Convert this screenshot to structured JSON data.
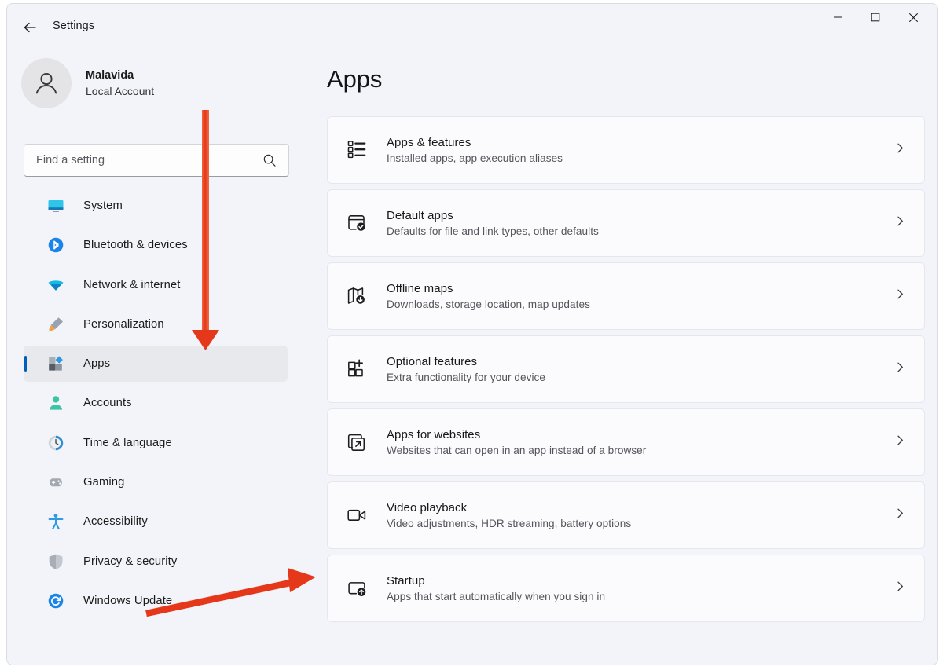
{
  "window": {
    "title": "Settings",
    "back_icon": "back-arrow-icon",
    "controls": {
      "minimize": "minimize-icon",
      "maximize": "maximize-icon",
      "close": "close-icon"
    }
  },
  "sidebar": {
    "profile": {
      "name": "Malavida",
      "subtitle": "Local Account",
      "avatar_icon": "person-avatar-icon"
    },
    "search": {
      "placeholder": "Find a setting",
      "value": "",
      "icon": "search-icon"
    },
    "items": [
      {
        "label": "System",
        "icon": "monitor-icon",
        "selected": false
      },
      {
        "label": "Bluetooth & devices",
        "icon": "bluetooth-icon",
        "selected": false
      },
      {
        "label": "Network & internet",
        "icon": "wifi-icon",
        "selected": false
      },
      {
        "label": "Personalization",
        "icon": "paintbrush-icon",
        "selected": false
      },
      {
        "label": "Apps",
        "icon": "apps-icon",
        "selected": true
      },
      {
        "label": "Accounts",
        "icon": "person-icon",
        "selected": false
      },
      {
        "label": "Time & language",
        "icon": "clock-icon",
        "selected": false
      },
      {
        "label": "Gaming",
        "icon": "gamepad-icon",
        "selected": false
      },
      {
        "label": "Accessibility",
        "icon": "accessibility-icon",
        "selected": false
      },
      {
        "label": "Privacy & security",
        "icon": "shield-icon",
        "selected": false
      },
      {
        "label": "Windows Update",
        "icon": "update-icon",
        "selected": false
      }
    ]
  },
  "main": {
    "title": "Apps",
    "cards": [
      {
        "title": "Apps & features",
        "subtitle": "Installed apps, app execution aliases",
        "icon": "list-bullets-icon",
        "chevron": "chevron-right-icon"
      },
      {
        "title": "Default apps",
        "subtitle": "Defaults for file and link types, other defaults",
        "icon": "window-check-icon",
        "chevron": "chevron-right-icon"
      },
      {
        "title": "Offline maps",
        "subtitle": "Downloads, storage location, map updates",
        "icon": "map-download-icon",
        "chevron": "chevron-right-icon"
      },
      {
        "title": "Optional features",
        "subtitle": "Extra functionality for your device",
        "icon": "grid-plus-icon",
        "chevron": "chevron-right-icon"
      },
      {
        "title": "Apps for websites",
        "subtitle": "Websites that can open in an app instead of a browser",
        "icon": "external-link-stack-icon",
        "chevron": "chevron-right-icon"
      },
      {
        "title": "Video playback",
        "subtitle": "Video adjustments, HDR streaming, battery options",
        "icon": "video-camera-icon",
        "chevron": "chevron-right-icon"
      },
      {
        "title": "Startup",
        "subtitle": "Apps that start automatically when you sign in",
        "icon": "window-up-arrow-icon",
        "chevron": "chevron-right-icon"
      }
    ]
  },
  "annotations": {
    "color": "#ea3a1b",
    "arrows": [
      {
        "name": "arrow-pointing-to-apps",
        "direction": "down"
      },
      {
        "name": "arrow-pointing-to-startup",
        "direction": "right"
      }
    ]
  },
  "colors": {
    "window_background": "#f3f4f9",
    "card_background": "#fbfbfd",
    "accent": "#005fb8",
    "selected_nav": "#e8e9ed",
    "annotation_red": "#ea3a1b"
  }
}
